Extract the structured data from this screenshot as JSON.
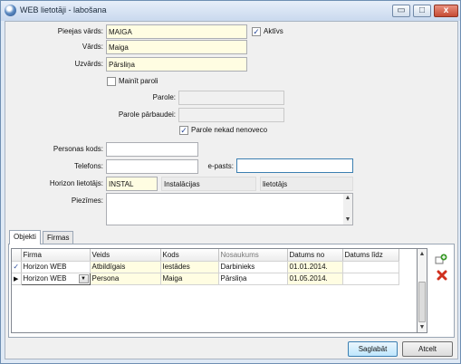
{
  "window": {
    "title": "WEB lietotāji - labošana",
    "controls": {
      "minimize": "▭",
      "maximize": "□",
      "close": "x"
    }
  },
  "form": {
    "login_label": "Pieejas vārds:",
    "login_value": "MAIGA",
    "active_label": "Aktīvs",
    "active_checked": true,
    "first_name_label": "Vārds:",
    "first_name_value": "Maiga",
    "last_name_label": "Uzvārds:",
    "last_name_value": "Pārsliņa",
    "change_password_label": "Mainīt paroli",
    "change_password_checked": false,
    "password_label": "Parole:",
    "password_value": "",
    "password_confirm_label": "Parole pārbaudei:",
    "password_confirm_value": "",
    "never_expire_label": "Parole nekad nenoveco",
    "never_expire_checked": true,
    "personal_code_label": "Personas kods:",
    "personal_code_value": "",
    "phone_label": "Telefons:",
    "phone_value": "",
    "email_label": "e-pasts:",
    "email_value": "",
    "horizon_user_label": "Horizon lietotājs:",
    "horizon_user_code": "INSTAL",
    "horizon_user_name": "Instalācijas",
    "horizon_user_type": "lietotājs",
    "notes_label": "Piezīmes:",
    "notes_value": ""
  },
  "tabs": [
    {
      "label": "Objekti",
      "active": true
    },
    {
      "label": "Firmas",
      "active": false
    }
  ],
  "grid": {
    "columns": [
      "Firma",
      "Veids",
      "Kods",
      "Nosaukums",
      "Datums no",
      "Datums līdz"
    ],
    "rows": [
      {
        "indicator": "✓",
        "firma": "Horizon WEB",
        "veids": "Atbildīgais",
        "kods": "Iestādes",
        "nosaukums": "Darbinieks",
        "datums_no": "01.01.2014.",
        "datums_lidz": ""
      },
      {
        "indicator": "▶",
        "firma": "Horizon WEB",
        "veids": "Persona",
        "kods": "Maiga",
        "nosaukums": "Pārsliņa",
        "datums_no": "01.05.2014.",
        "datums_lidz": ""
      }
    ]
  },
  "buttons": {
    "save": "Saglabāt",
    "cancel": "Atcelt"
  },
  "colors": {
    "accent": "#3c7fb1",
    "add_icon": "#3a9a2a",
    "delete_icon": "#d0301e",
    "highlight_field": "#fffde2"
  }
}
